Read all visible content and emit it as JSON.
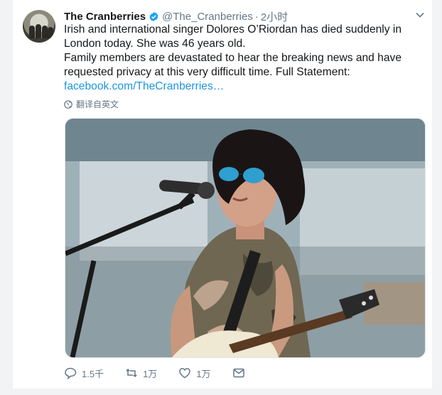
{
  "tweet": {
    "author_name": "The Cranberries",
    "handle": "@The_Cranberries",
    "separator": "·",
    "time": "2小时",
    "paragraphs": [
      "Irish and international singer Dolores O’Riordan has died suddenly in London today. She was 46 years old.",
      "Family members are devastated to hear the breaking news and have requested privacy at this very difficult time. Full Statement:"
    ],
    "link_text": "facebook.com/TheCranberries…",
    "translate_label": "翻译自英文"
  },
  "actions": {
    "reply_count": "1.5千",
    "retweet_count": "1万",
    "like_count": "1万"
  },
  "colors": {
    "link": "#1b95e0",
    "verified": "#1da1f2",
    "muted": "#657786"
  },
  "icons": [
    "verified-badge-icon",
    "chevron-down-icon",
    "globe-icon",
    "reply-icon",
    "retweet-icon",
    "like-icon",
    "direct-message-icon"
  ]
}
